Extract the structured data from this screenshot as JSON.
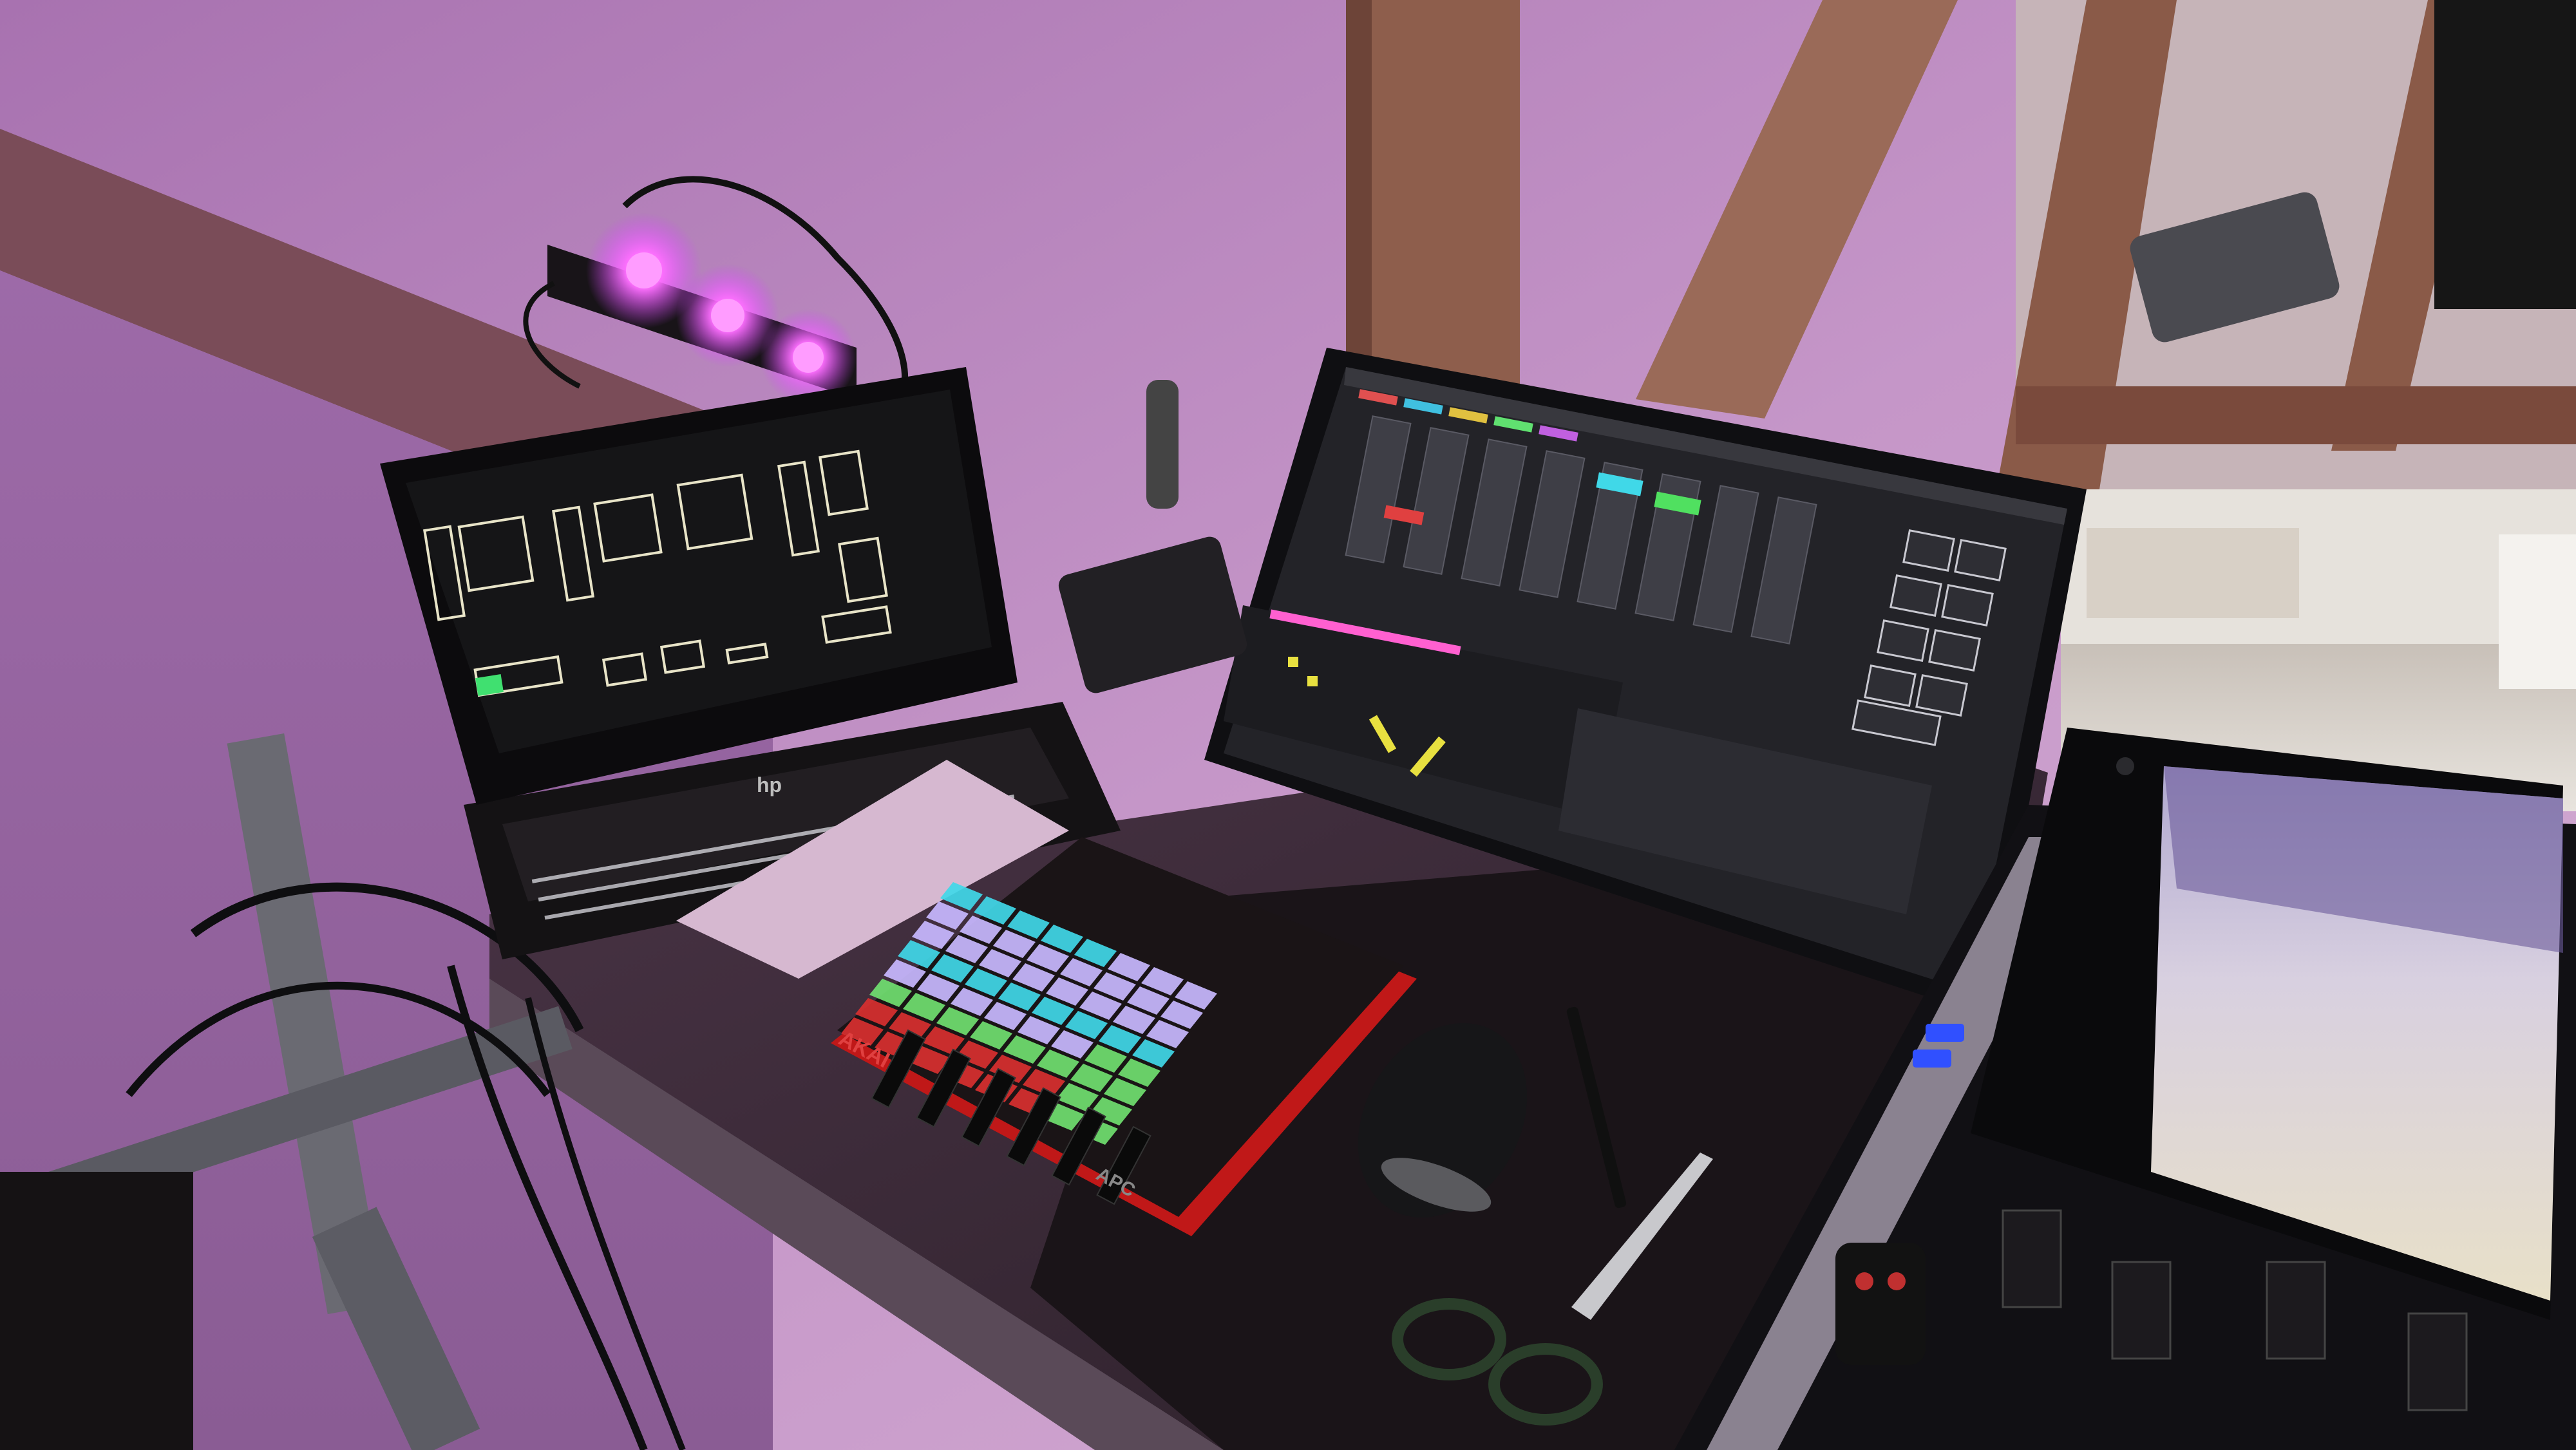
{
  "scene": {
    "title": "",
    "description_visible_text": "",
    "colors": {
      "wall_magenta": "#b07ab8",
      "wall_light": "#d8b6d6",
      "wood_beam": "#8a5a48",
      "table_top": "#3a2c36",
      "monitor_bg": "#1e1e22",
      "laptop_screen_bg": "#151517",
      "pad_red": "#d83030",
      "pad_cyan": "#40d8e8",
      "pad_green": "#70e070",
      "pad_lilac": "#c8b8ff",
      "led_purple": "#d040ff"
    }
  },
  "laptop": {
    "brand_logo": "hp",
    "screen_icon": "lighting-console-icon"
  },
  "monitor": {
    "app": "lighting-control-software",
    "buttons": [
      "",
      "",
      "",
      "",
      "",
      "",
      "",
      "",
      "",
      ""
    ]
  },
  "midi_controller": {
    "brand": "AKAI",
    "model": "APC"
  },
  "phone": {
    "camera_icon": "camera-icon"
  }
}
